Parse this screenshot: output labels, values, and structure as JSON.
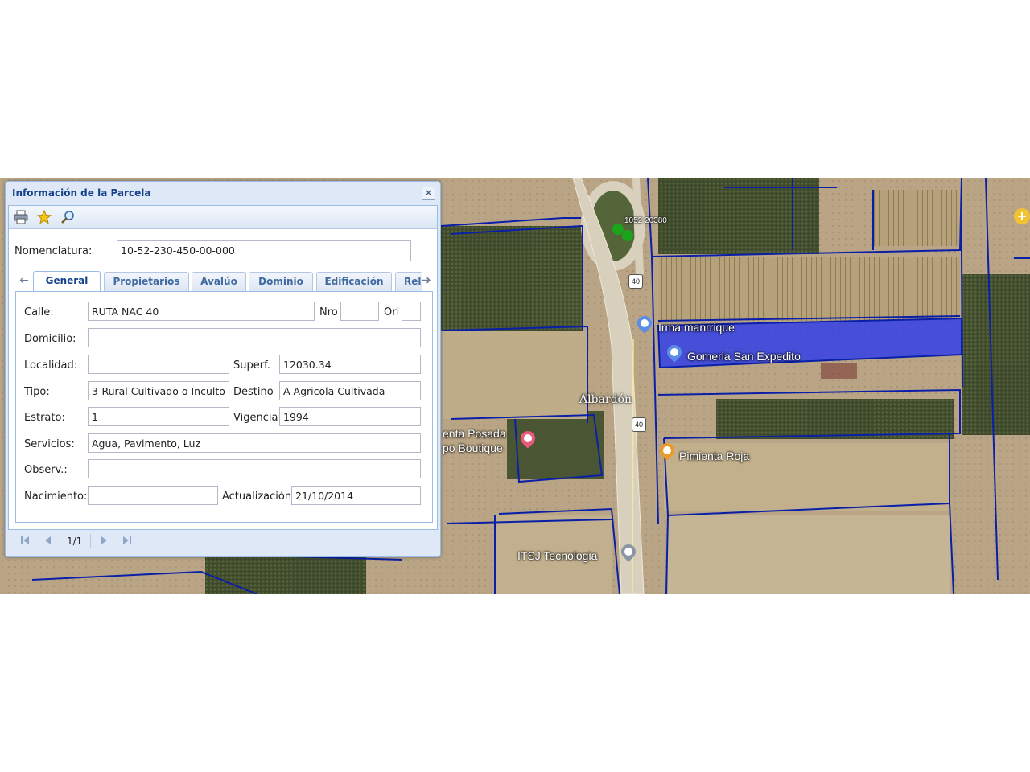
{
  "dialog": {
    "title": "Información de la Parcela",
    "close_glyph": "✕",
    "toolbar": {
      "icons": [
        "printer-icon",
        "star-icon",
        "search-icon"
      ]
    },
    "nomenclatura": {
      "label": "Nomenclatura:",
      "value": "10-52-230-450-00-000"
    },
    "tabs": {
      "prev_glyph": "←",
      "next_glyph": "➜",
      "items": [
        {
          "label": "General",
          "active": true
        },
        {
          "label": "Propietarios"
        },
        {
          "label": "Avalúo"
        },
        {
          "label": "Dominio"
        },
        {
          "label": "Edificación"
        },
        {
          "label": "Rel"
        }
      ]
    },
    "general": {
      "calle_label": "Calle:",
      "calle": "RUTA NAC 40",
      "nro_label": "Nro",
      "nro": "",
      "ori_label": "Ori",
      "ori": "",
      "domicilio_label": "Domicilio:",
      "domicilio": "",
      "localidad_label": "Localidad:",
      "localidad": "",
      "superf_label": "Superf.",
      "superf": "12030.34",
      "tipo_label": "Tipo:",
      "tipo": "3-Rural Cultivado o Inculto",
      "destino_label": "Destino",
      "destino": "A-Agricola Cultivada",
      "estrato_label": "Estrato:",
      "estrato": "1",
      "vigencia_label": "Vigencia",
      "vigencia": "1994",
      "servicios_label": "Servicios:",
      "servicios": "Agua, Pavimento, Luz",
      "observ_label": "Observ.:",
      "observ": "",
      "nacimiento_label": "Nacimiento:",
      "nacimiento": "",
      "actualizacion_label": "Actualización",
      "actualizacion": "21/10/2014"
    },
    "paging": {
      "text": "1/1"
    }
  },
  "map": {
    "labels": {
      "parcel_id": "1052 20380",
      "route_a": "40",
      "route_b": "40",
      "irma": "Irma manrrique",
      "gomeria": "Gomeria San Expedito",
      "town": "Albardón",
      "posada_1": "enta Posada",
      "posada_2": "po Boutique",
      "pimienta": "Pimienta Roja",
      "itsj": "ITSJ Tecnologia"
    },
    "edge_button": "+",
    "colors": {
      "parcel_outline": "#0a1fa8",
      "parcel_highlight": "#3340e6",
      "selection_dot": "#1aa51a"
    }
  }
}
